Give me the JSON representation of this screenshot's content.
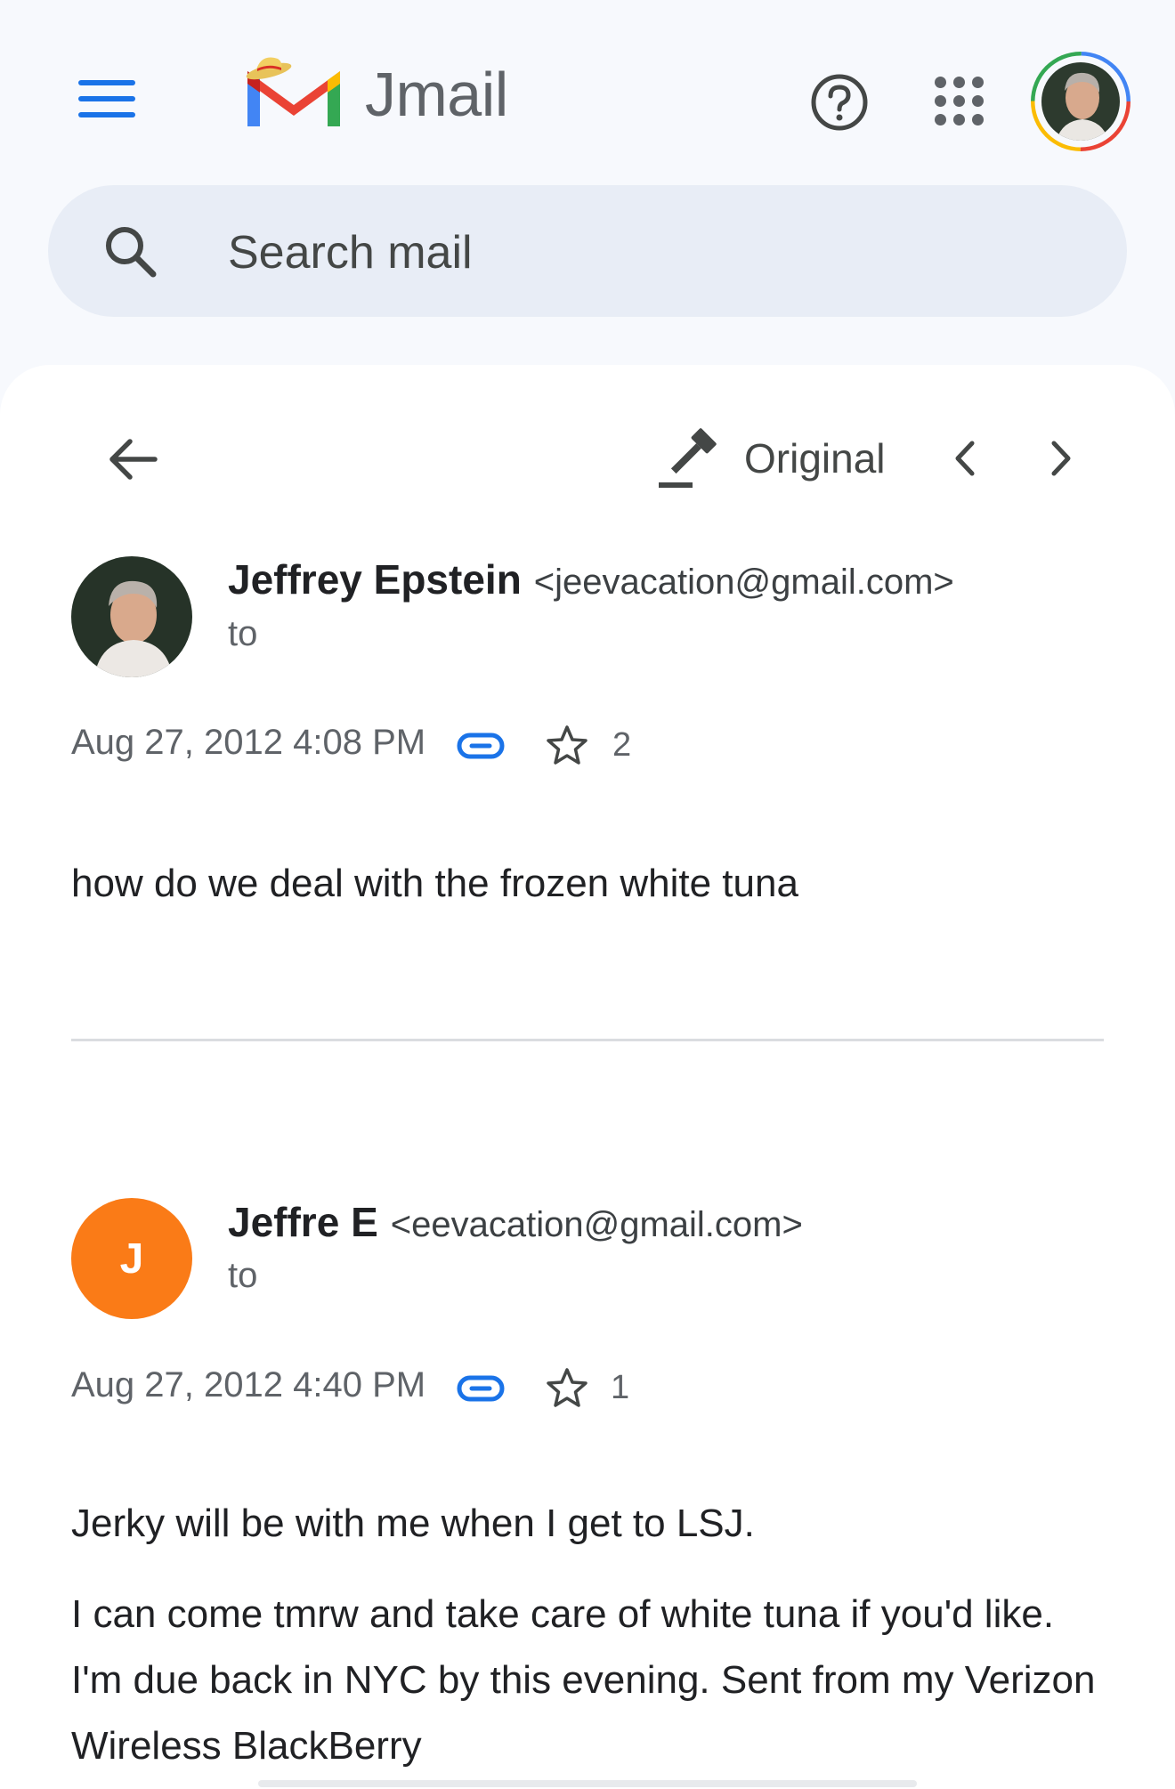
{
  "header": {
    "brand": "Jmail",
    "help_icon": "help-circle-icon",
    "apps_icon": "apps-grid-icon",
    "account_icon": "account-avatar"
  },
  "search": {
    "placeholder": "Search mail"
  },
  "toolbar": {
    "original_label": "Original",
    "back_icon": "arrow-left-icon",
    "original_icon": "gavel-icon",
    "prev_icon": "chevron-left-icon",
    "next_icon": "chevron-right-icon"
  },
  "messages": [
    {
      "sender_name": "Jeffrey Epstein",
      "sender_email": "<jeevacation@gmail.com>",
      "to_label": "to",
      "timestamp": "Aug 27, 2012 4:08 PM",
      "star_count": "2",
      "body": [
        "how do we deal with the frozen white tuna"
      ]
    },
    {
      "sender_name": "Jeffre E",
      "sender_email": "<eevacation@gmail.com>",
      "avatar_letter": "J",
      "avatar_color": "#fa7b17",
      "to_label": "to",
      "timestamp": "Aug 27, 2012 4:40 PM",
      "star_count": "1",
      "body": [
        "Jerky will be with me when I get to LSJ.",
        "I can come tmrw and take care of white tuna if you'd like. I'm due back in NYC by this evening. Sent from my Verizon Wireless BlackBerry"
      ]
    }
  ],
  "colors": {
    "accent": "#1a73e8",
    "background": "#f7f9fd",
    "search_bg": "#e8edf6",
    "card_bg": "#ffffff"
  }
}
